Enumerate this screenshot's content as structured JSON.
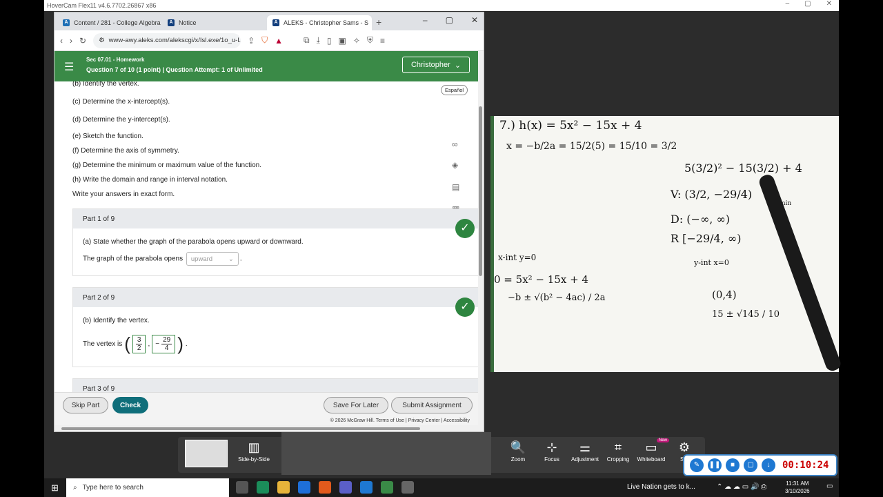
{
  "hovercam": {
    "title": "HoverCam Flex11 v4.6.7702.26867 x86",
    "window_controls": [
      "–",
      "▢",
      "✕"
    ]
  },
  "browser": {
    "tabs": [
      {
        "label": "Content / 281 - College Algebra",
        "icon": "A",
        "color": "#1e6fb5"
      },
      {
        "label": "Notice",
        "icon": "A",
        "color": "#123e7c"
      },
      {
        "label": "ALEKS - Christopher Sams - S",
        "icon": "A",
        "color": "#123e7c"
      }
    ],
    "new_tab": "+",
    "window_controls": [
      "–",
      "▢",
      "✕"
    ],
    "url": "www-awy.aleks.com/alekscgi/x/Isl.exe/1o_u-l..."
  },
  "aleks": {
    "section": "Sec 07.01 - Homework",
    "question_line": "Question 7 of 10 (1 point)  |  Question Attempt: 1 of Unlimited",
    "user": "Christopher",
    "espanol": "Español",
    "items": [
      "(b) Identify the vertex.",
      "(c) Determine the x-intercept(s).",
      "(d) Determine the y-intercept(s).",
      "(e) Sketch the function.",
      "(f) Determine the axis of symmetry.",
      "(g) Determine the minimum or maximum value of the function.",
      "(h) Write the domain and range in interval notation.",
      "Write your answers in exact form."
    ],
    "part1": {
      "title": "Part 1 of 9",
      "question": "(a) State whether the graph of the parabola opens upward or downward.",
      "answer_prefix": "The graph of the parabola opens",
      "answer_value": "upward",
      "answer_suffix": "."
    },
    "part2": {
      "title": "Part 2 of 9",
      "question": "(b) Identify the vertex.",
      "answer_prefix": "The vertex is",
      "x_num": "3",
      "x_den": "2",
      "y_sign": "−",
      "y_num": "29",
      "y_den": "4"
    },
    "part3": {
      "title": "Part 3 of 9"
    },
    "buttons": {
      "skip": "Skip Part",
      "check": "Check",
      "save": "Save For Later",
      "submit": "Submit Assignment"
    },
    "footer": "© 2026 McGraw Hill.  Terms of Use  |  Privacy Center  |  Accessibility"
  },
  "handwriting": [
    "7.) h(x) = 5x² − 15x + 4",
    "x = −b/2a = 15/2(5) = 15/10 = 3/2",
    "5(3/2)² − 15(3/2) + 4",
    "V: (3/2, −29/4)",
    "D: (−∞, ∞)",
    "R [−29/4, ∞)",
    "min",
    "x-int  y=0",
    "y-int  x=0",
    "0 = 5x² − 15x + 4",
    "(0,4)",
    "−b ± √(b² − 4ac) / 2a",
    "15 ± √145 / 10"
  ],
  "toolbar": [
    {
      "label": "Side-by-Side",
      "icon": "▥"
    },
    {
      "label": "Zoom",
      "icon": "🔍"
    },
    {
      "label": "Focus",
      "icon": "⊹"
    },
    {
      "label": "Adjustment",
      "icon": "⚌"
    },
    {
      "label": "Cropping",
      "icon": "⌗"
    },
    {
      "label": "Whiteboard",
      "icon": "▭",
      "badge": "New"
    },
    {
      "label": "Set",
      "icon": "⚙"
    }
  ],
  "recorder": {
    "time": "00:10:24"
  },
  "taskbar": {
    "search_placeholder": "Type here to search",
    "news": "Live Nation gets to k...",
    "time": "11:31 AM",
    "date": "3/10/2026"
  }
}
